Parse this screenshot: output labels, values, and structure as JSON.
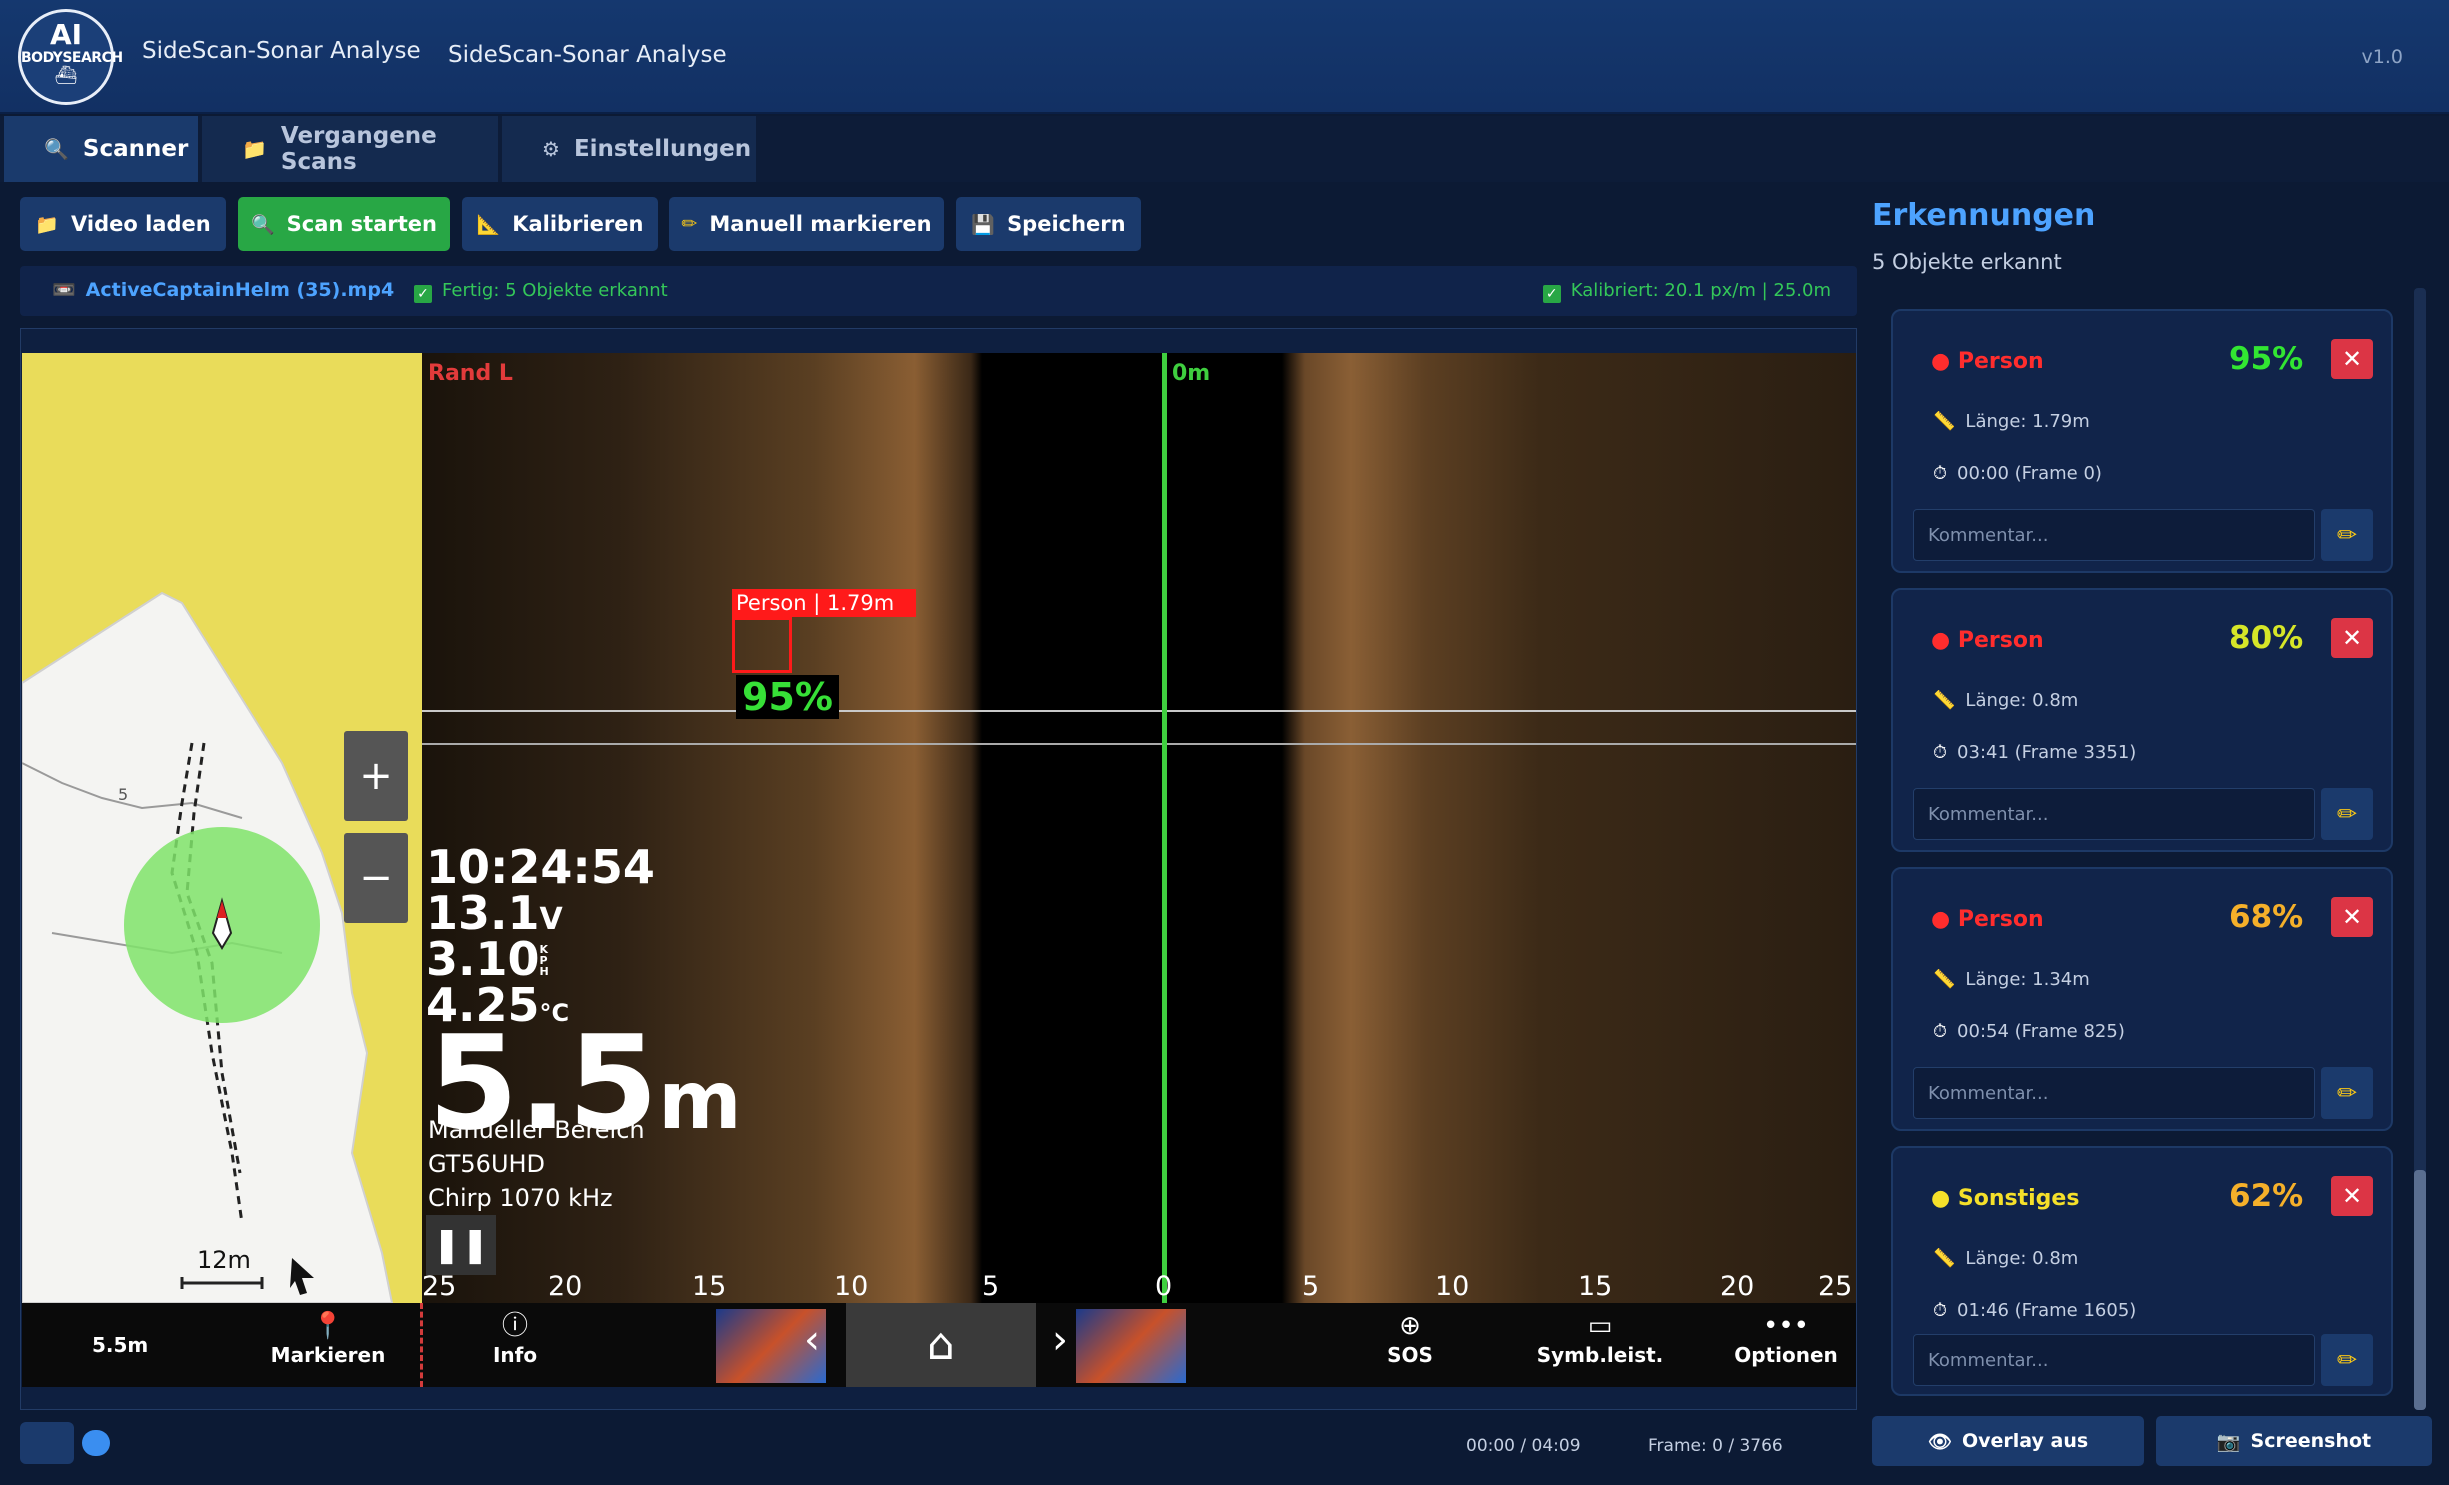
{
  "header": {
    "logo_line1": "AI",
    "logo_line2": "BODYSEARCH",
    "title": "SideScan-Sonar Analyse",
    "subtitle": "SideScan-Sonar Analyse",
    "version": "v1.0"
  },
  "tabs": [
    {
      "label": "Scanner",
      "icon": "search-icon",
      "active": true
    },
    {
      "label": "Vergangene Scans",
      "icon": "folder-icon",
      "active": false
    },
    {
      "label": "Einstellungen",
      "icon": "gear-icon",
      "active": false
    }
  ],
  "toolbar": {
    "load_video": "Video laden",
    "start_scan": "Scan starten",
    "calibrate": "Kalibrieren",
    "mark_manual": "Manuell markieren",
    "save": "Speichern"
  },
  "status": {
    "file_name": "ActiveCaptainHelm (35).mp4",
    "scan_status": "Fertig: 5 Objekte erkannt",
    "calibration": "Kalibriert: 20.1 px/m | 25.0m"
  },
  "video": {
    "edge_label": "Rand L",
    "center_label": "0m",
    "detection_label": "Person | 1.79m",
    "detection_confidence": "95%",
    "clock": "10:24:54",
    "voltage": "13.1",
    "voltage_unit": "V",
    "speed": "3.10",
    "speed_unit": "KPH",
    "temperature": "4.25",
    "temperature_unit": "°C",
    "depth": "5.5",
    "depth_unit": "m",
    "range_mode": "Manueller Bereich",
    "transducer": "GT56UHD",
    "frequency": "Chirp 1070 kHz",
    "map_scale": "12m",
    "map_depth_mark": "5",
    "range_ticks": [
      "25",
      "20",
      "15",
      "10",
      "5",
      "0",
      "5",
      "10",
      "15",
      "20",
      "25"
    ],
    "bottom_bar": {
      "depth": "5.5m",
      "markieren": "Markieren",
      "info": "Info",
      "sos": "SOS",
      "symb": "Symb.leist.",
      "optionen": "Optionen"
    }
  },
  "timeline": {
    "time": "00:00 / 04:09",
    "frame": "Frame: 0 / 3766",
    "progress": 0
  },
  "panel": {
    "title": "Erkennungen",
    "subtitle": "5 Objekte erkannt",
    "comment_placeholder": "Kommentar...",
    "detections": [
      {
        "cls": "Person",
        "confidence": "95%",
        "length": "Länge: 1.79m",
        "time": "00:00 (Frame 0)",
        "cls_color": "#ff2d2d",
        "conf_color": "#32e632"
      },
      {
        "cls": "Person",
        "confidence": "80%",
        "length": "Länge: 0.8m",
        "time": "03:41 (Frame 3351)",
        "cls_color": "#ff2d2d",
        "conf_color": "#d6e628"
      },
      {
        "cls": "Person",
        "confidence": "68%",
        "length": "Länge: 1.34m",
        "time": "00:54 (Frame 825)",
        "cls_color": "#ff2d2d",
        "conf_color": "#f5b02a"
      },
      {
        "cls": "Sonstiges",
        "confidence": "62%",
        "length": "Länge: 0.8m",
        "time": "01:46 (Frame 1605)",
        "cls_color": "#f5e02a",
        "conf_color": "#f5b02a"
      }
    ],
    "overlay_button": "Overlay aus",
    "screenshot_button": "Screenshot"
  }
}
